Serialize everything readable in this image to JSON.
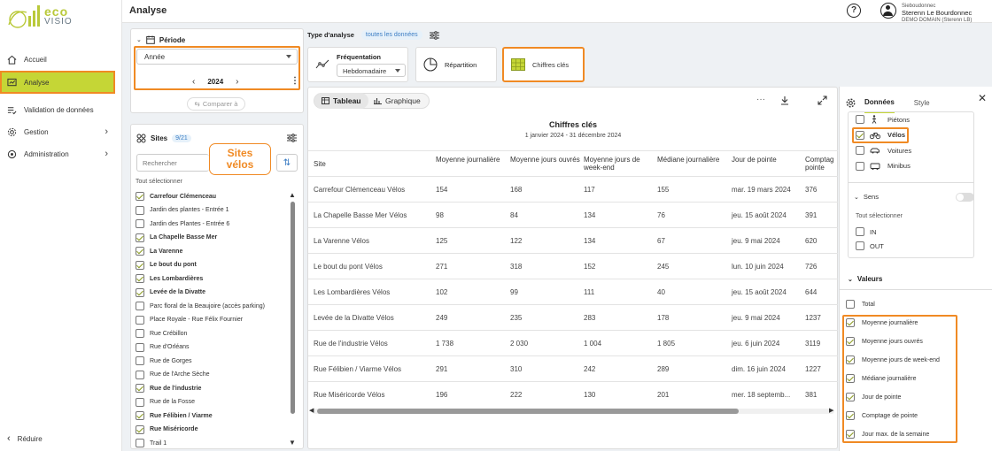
{
  "app": {
    "logo_top": "eco",
    "logo_bottom": "VISIO",
    "page_title": "Analyse"
  },
  "nav": [
    {
      "label": "Accueil",
      "icon": "home-icon"
    },
    {
      "label": "Analyse",
      "icon": "chart-icon",
      "active": true
    },
    {
      "label": "Validation de données",
      "icon": "list-check-icon"
    },
    {
      "label": "Gestion",
      "icon": "gear-icon",
      "chevron": true
    },
    {
      "label": "Administration",
      "icon": "settings-icon",
      "chevron": true
    }
  ],
  "nav_collapse": "Réduire",
  "user": {
    "login": "Sieboudonnec",
    "name": "Sterenn Le Bourdonnec",
    "domain": "DEMO DOMAIN (Sterenn LB)"
  },
  "periode": {
    "title": "Période",
    "select_value": "Année",
    "year": "2024",
    "compare": "Comparer à"
  },
  "sites": {
    "title": "Sites",
    "count": "9/21",
    "annotation": "Sites vélos",
    "search_placeholder": "Rechercher",
    "select_all": "Tout sélectionner",
    "items": [
      {
        "label": "Carrefour Clémenceau",
        "checked": true
      },
      {
        "label": "Jardin des plantes - Entrée 1",
        "checked": false
      },
      {
        "label": "Jardin des Plantes - Entrée 6",
        "checked": false
      },
      {
        "label": "La Chapelle Basse Mer",
        "checked": true
      },
      {
        "label": "La Varenne",
        "checked": true
      },
      {
        "label": "Le bout du pont",
        "checked": true
      },
      {
        "label": "Les Lombardières",
        "checked": true
      },
      {
        "label": "Levée de la Divatte",
        "checked": true
      },
      {
        "label": "Parc floral de la Beaujoire (accès parking)",
        "checked": false
      },
      {
        "label": "Place Royale - Rue Félix Fournier",
        "checked": false
      },
      {
        "label": "Rue Crébillon",
        "checked": false
      },
      {
        "label": "Rue d'Orléans",
        "checked": false
      },
      {
        "label": "Rue de Gorges",
        "checked": false
      },
      {
        "label": "Rue de l'Arche Sèche",
        "checked": false
      },
      {
        "label": "Rue de l'industrie",
        "checked": true
      },
      {
        "label": "Rue de la Fosse",
        "checked": false
      },
      {
        "label": "Rue Félibien / Viarme",
        "checked": true
      },
      {
        "label": "Rue Miséricorde",
        "checked": true
      },
      {
        "label": "Trail 1",
        "checked": false
      }
    ]
  },
  "analysis": {
    "type_label": "Type d'analyse",
    "type_badge": "toutes les données",
    "frequentation_label": "Fréquentation",
    "frequentation_value": "Hebdomadaire",
    "repartition": "Répartition",
    "chiffres_cles": "Chiffres clés"
  },
  "view": {
    "tab_table": "Tableau",
    "tab_graph": "Graphique",
    "more": "···"
  },
  "table": {
    "title": "Chiffres clés",
    "subtitle": "1 janvier 2024 - 31 décembre 2024",
    "columns": [
      "Site",
      "Moyenne journalière",
      "Moyenne jours ouvrés",
      "Moyenne jours de week-end",
      "Médiane journalière",
      "Jour de pointe",
      "Comptag pointe"
    ],
    "rows": [
      [
        "Carrefour Clémenceau Vélos",
        "154",
        "168",
        "117",
        "155",
        "mar. 19 mars 2024",
        "376"
      ],
      [
        "La Chapelle Basse Mer Vélos",
        "98",
        "84",
        "134",
        "76",
        "jeu. 15 août 2024",
        "391"
      ],
      [
        "La Varenne Vélos",
        "125",
        "122",
        "134",
        "67",
        "jeu. 9 mai 2024",
        "620"
      ],
      [
        "Le bout du pont Vélos",
        "271",
        "318",
        "152",
        "245",
        "lun. 10 juin 2024",
        "726"
      ],
      [
        "Les Lombardières Vélos",
        "102",
        "99",
        "111",
        "40",
        "jeu. 15 août 2024",
        "644"
      ],
      [
        "Levée de la Divatte Vélos",
        "249",
        "235",
        "283",
        "178",
        "jeu. 9 mai 2024",
        "1237"
      ],
      [
        "Rue de l'industrie Vélos",
        "1 738",
        "2 030",
        "1 004",
        "1 805",
        "jeu. 6 juin 2024",
        "3119"
      ],
      [
        "Rue Félibien / Viarme Vélos",
        "291",
        "310",
        "242",
        "289",
        "dim. 16 juin 2024",
        "1227"
      ],
      [
        "Rue Miséricorde Vélos",
        "196",
        "222",
        "130",
        "201",
        "mer. 18 septemb...",
        "381"
      ]
    ]
  },
  "right_panel": {
    "tab_data": "Données",
    "tab_style": "Style",
    "modes": [
      {
        "label": "Piétons",
        "checked": false
      },
      {
        "label": "Vélos",
        "checked": true
      },
      {
        "label": "Voitures",
        "checked": false
      },
      {
        "label": "Minibus",
        "checked": false
      }
    ],
    "sens_title": "Sens",
    "sens_select_all": "Tout sélectionner",
    "sens_options": [
      "IN",
      "OUT"
    ],
    "valeurs_title": "Valeurs",
    "valeurs": [
      {
        "label": "Total",
        "checked": false
      },
      {
        "label": "Moyenne journalière",
        "checked": true
      },
      {
        "label": "Moyenne jours ouvrés",
        "checked": true
      },
      {
        "label": "Moyenne jours de week-end",
        "checked": true
      },
      {
        "label": "Médiane journalière",
        "checked": true
      },
      {
        "label": "Jour de pointe",
        "checked": true
      },
      {
        "label": "Comptage de pointe",
        "checked": true
      },
      {
        "label": "Jour max. de la semaine",
        "checked": true
      }
    ]
  },
  "colors": {
    "accent": "#c5d636",
    "highlight": "#f08a24",
    "brand_green": "#b9c93a"
  }
}
